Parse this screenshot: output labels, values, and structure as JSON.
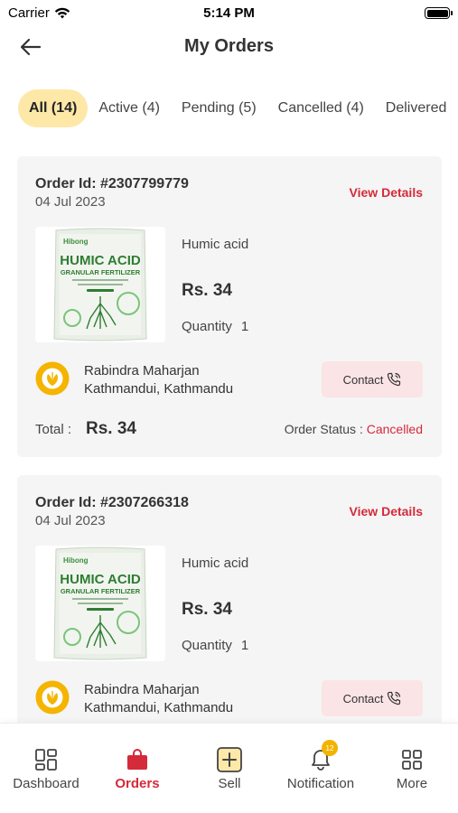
{
  "status_bar": {
    "carrier": "Carrier",
    "time": "5:14 PM"
  },
  "header": {
    "title": "My Orders"
  },
  "tabs": [
    {
      "label": "All (14)",
      "active": true
    },
    {
      "label": "Active (4)",
      "active": false
    },
    {
      "label": "Pending (5)",
      "active": false
    },
    {
      "label": "Cancelled (4)",
      "active": false
    },
    {
      "label": "Delivered",
      "active": false
    }
  ],
  "orders": [
    {
      "order_id": "Order Id: #2307799779",
      "date": "04 Jul 2023",
      "view_details": "View Details",
      "product_name": "Humic acid",
      "price": "Rs. 34",
      "quantity_label": "Quantity",
      "quantity": "1",
      "seller_name": "Rabindra Maharjan",
      "seller_location": "Kathmandui, Kathmandu",
      "contact_label": "Contact",
      "total_label": "Total :",
      "total_value": "Rs. 34",
      "status_label": "Order Status :",
      "status_value": "Cancelled",
      "package": {
        "brand": "Hibong",
        "line1": "HUMIC ACID",
        "line2": "GRANULAR FERTILIZER"
      }
    },
    {
      "order_id": "Order Id: #2307266318",
      "date": "04 Jul 2023",
      "view_details": "View Details",
      "product_name": "Humic acid",
      "price": "Rs. 34",
      "quantity_label": "Quantity",
      "quantity": "1",
      "seller_name": "Rabindra Maharjan",
      "seller_location": "Kathmandui, Kathmandu",
      "contact_label": "Contact",
      "package": {
        "brand": "Hibong",
        "line1": "HUMIC ACID",
        "line2": "GRANULAR FERTILIZER"
      }
    }
  ],
  "bottom_nav": [
    {
      "label": "Dashboard",
      "icon": "dashboard-icon",
      "active": false
    },
    {
      "label": "Orders",
      "icon": "shopping-bag-icon",
      "active": true
    },
    {
      "label": "Sell",
      "icon": "plus-square-icon",
      "active": false
    },
    {
      "label": "Notification",
      "icon": "bell-icon",
      "active": false,
      "badge": "12"
    },
    {
      "label": "More",
      "icon": "grid-icon",
      "active": false
    }
  ],
  "colors": {
    "accent": "#d42a3a",
    "active_tab_bg": "#fde8a8",
    "card_bg": "#f5f5f5",
    "contact_bg": "#fbe4e6",
    "badge": "#f2b400"
  }
}
